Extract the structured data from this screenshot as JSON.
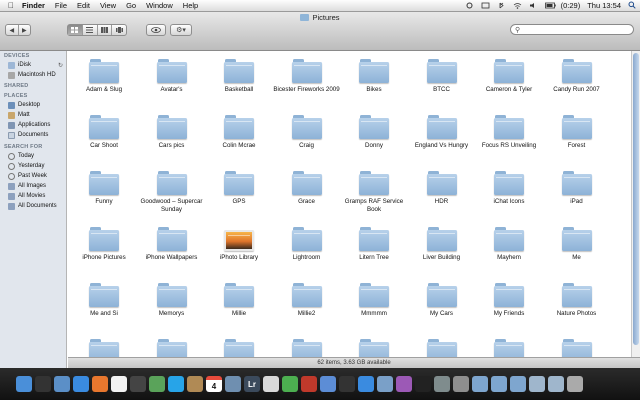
{
  "menubar": {
    "app": "Finder",
    "menus": [
      "File",
      "Edit",
      "View",
      "Go",
      "Window",
      "Help"
    ],
    "battery": "(0:29)",
    "clock": "Thu 13:54"
  },
  "window": {
    "title": "Pictures"
  },
  "sidebar": {
    "devices_header": "DEVICES",
    "devices": [
      "iDisk",
      "Macintosh HD"
    ],
    "shared_header": "SHARED",
    "places_header": "PLACES",
    "places": [
      "Desktop",
      "Matt",
      "Applications",
      "Documents"
    ],
    "search_header": "SEARCH FOR",
    "search": [
      "Today",
      "Yesterday",
      "Past Week",
      "All Images",
      "All Movies",
      "All Documents"
    ]
  },
  "folders": [
    "Adam & Slug",
    "Avatar's",
    "Basketball",
    "Bicester Fireworks 2009",
    "Bikes",
    "BTCC",
    "Cameron & Tyler",
    "Candy Run 2007",
    "Car Shoot",
    "Cars pics",
    "Colin Mcrae",
    "Craig",
    "Donny",
    "England Vs Hungry",
    "Focus RS Unveiling",
    "Forest",
    "Funny",
    "Goodwood – Supercar Sunday",
    "GPS",
    "Grace",
    "Gramps RAF Service Book",
    "HDR",
    "iChat Icons",
    "iPad",
    "iPhone Pictures",
    "iPhone Wallpapers",
    "iPhoto Library",
    "Lightroom",
    "Litern Tree",
    "Liver Building",
    "Mayhem",
    "Me",
    "Me and Si",
    "Memorys",
    "Millie",
    "Millie2",
    "Mmmmm",
    "My Cars",
    "My Friends",
    "Nature Photos"
  ],
  "status": "62 items, 3.63 GB available",
  "dock_calendar_day": "4",
  "dock_lr_label": "Lr"
}
